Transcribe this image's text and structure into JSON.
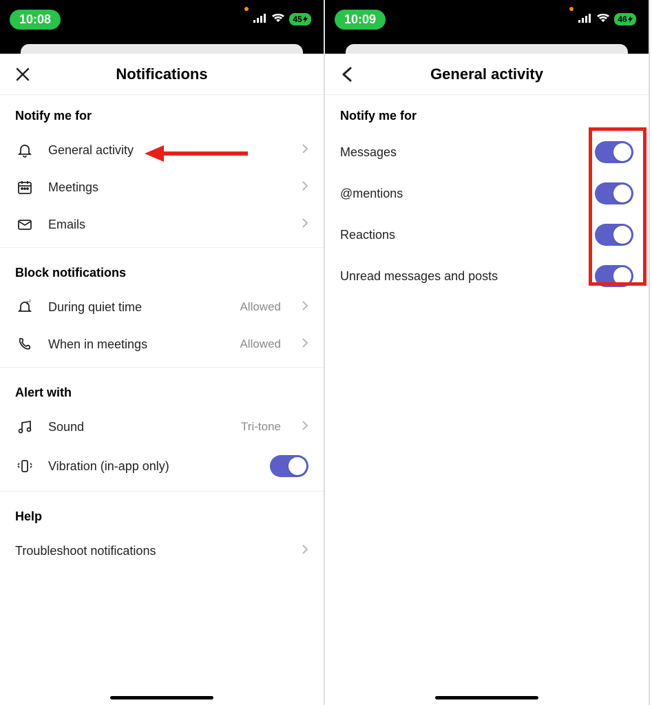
{
  "left": {
    "status": {
      "time": "10:08",
      "battery": "45"
    },
    "nav": {
      "title": "Notifications"
    },
    "sections": {
      "notify_header": "Notify me for",
      "notify_items": [
        {
          "label": "General activity"
        },
        {
          "label": "Meetings"
        },
        {
          "label": "Emails"
        }
      ],
      "block_header": "Block notifications",
      "block_items": [
        {
          "label": "During quiet time",
          "value": "Allowed"
        },
        {
          "label": "When in meetings",
          "value": "Allowed"
        }
      ],
      "alert_header": "Alert with",
      "alert_sound": {
        "label": "Sound",
        "value": "Tri-tone"
      },
      "alert_vibration": {
        "label": "Vibration (in-app only)"
      },
      "help_header": "Help",
      "help_item": {
        "label": "Troubleshoot notifications"
      }
    }
  },
  "right": {
    "status": {
      "time": "10:09",
      "battery": "46"
    },
    "nav": {
      "title": "General activity"
    },
    "section_header": "Notify me for",
    "toggles": [
      {
        "label": "Messages",
        "on": true
      },
      {
        "label": "@mentions",
        "on": true
      },
      {
        "label": "Reactions",
        "on": true
      },
      {
        "label": "Unread messages and posts",
        "on": true
      }
    ]
  },
  "annotations": {
    "arrow_target": "general-activity-row",
    "highlight_target": "toggles-group"
  }
}
